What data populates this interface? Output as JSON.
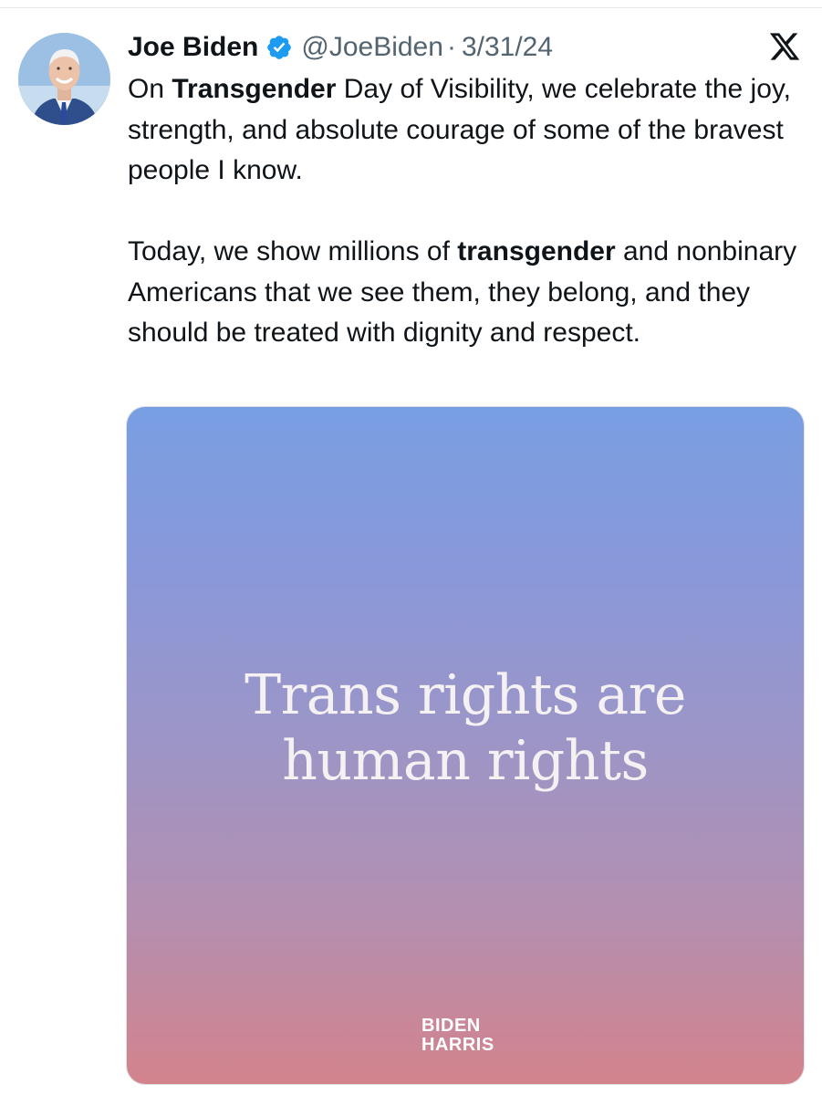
{
  "tweet": {
    "author": {
      "name": "Joe Biden",
      "handle": "@JoeBiden",
      "date": "3/31/24",
      "separator": "·"
    },
    "paragraphs": [
      [
        {
          "text": "On ",
          "bold": false
        },
        {
          "text": "Transgender",
          "bold": true
        },
        {
          "text": " Day of Visibility, we celebrate the joy, strength, and absolute courage of some of the bravest people I know.",
          "bold": false
        }
      ],
      [
        {
          "text": "Today, we show millions of ",
          "bold": false
        },
        {
          "text": "transgender",
          "bold": true
        },
        {
          "text": " and nonbinary Americans that we see them, they belong, and they should be treated with dignity and respect.",
          "bold": false
        }
      ]
    ],
    "media": {
      "title_lines": [
        "Trans rights are",
        "human rights"
      ],
      "logo_lines": [
        "BIDEN",
        "HARRIS"
      ],
      "gradient_top": "#789fe2",
      "gradient_bottom": "#d3838c"
    }
  },
  "icons": {
    "verified": "verified-badge-icon",
    "platform": "x-logo-icon"
  },
  "colors": {
    "verified_badge": "#1d9bf0",
    "secondary_text": "#536471",
    "primary_text": "#0f1419"
  }
}
